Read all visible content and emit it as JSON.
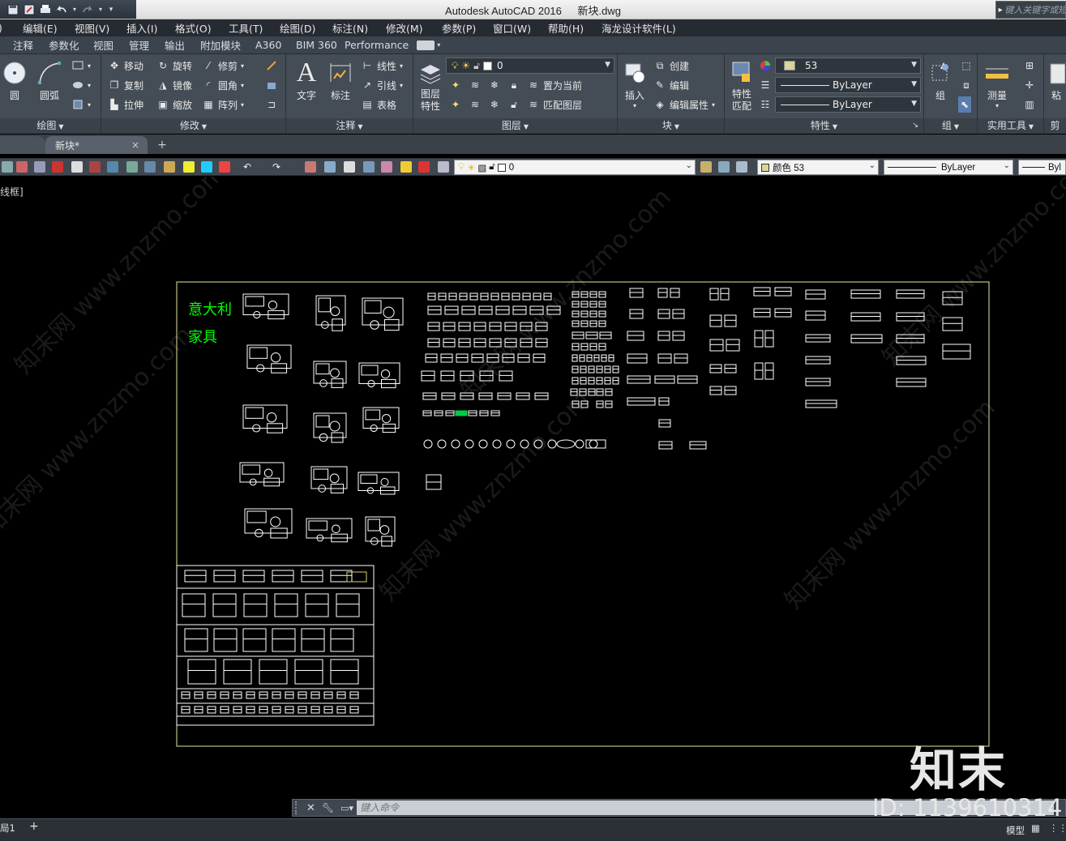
{
  "window": {
    "app_name": "Autodesk AutoCAD 2016",
    "file_name": "新块.dwg",
    "keyword_search_placeholder": "键入关键字或短语"
  },
  "menu": [
    "编辑(E)",
    "视图(V)",
    "插入(I)",
    "格式(O)",
    "工具(T)",
    "绘图(D)",
    "标注(N)",
    "修改(M)",
    "参数(P)",
    "窗口(W)",
    "帮助(H)",
    "海龙设计软件(L)"
  ],
  "ribbon_tabs": [
    "注释",
    "参数化",
    "视图",
    "管理",
    "输出",
    "附加模块",
    "A360",
    "BIM 360",
    "Performance"
  ],
  "ribbon": {
    "draw": {
      "title": "绘图",
      "circle": "圆",
      "arc": "圆弧"
    },
    "modify": {
      "title": "修改",
      "move": "移动",
      "rotate": "旋转",
      "trim": "修剪",
      "copy": "复制",
      "mirror": "镜像",
      "fillet": "圆角",
      "stretch": "拉伸",
      "scale": "缩放",
      "array": "阵列"
    },
    "annotation": {
      "title": "注释",
      "text": "文字",
      "dimension": "标注",
      "linear": "线性",
      "leader": "引线",
      "table": "表格"
    },
    "layers": {
      "title": "图层",
      "layer_properties": "图层特性",
      "current_layer": "0",
      "set_current": "置为当前",
      "match_layer": "匹配图层"
    },
    "block": {
      "title": "块",
      "insert": "插入",
      "create": "创建",
      "edit": "编辑",
      "edit_attributes": "编辑属性"
    },
    "properties": {
      "title": "特性",
      "match_properties": "特性匹配",
      "color": "53",
      "linetype": "ByLayer",
      "lineweight": "ByLayer"
    },
    "groups": {
      "title": "组",
      "group": "组"
    },
    "utilities": {
      "title": "实用工具",
      "measure": "测量"
    },
    "clipboard": {
      "title": "剪",
      "paste": "粘"
    }
  },
  "file_tabs": {
    "active": "新块*"
  },
  "toolbar": {
    "layer_value": "0",
    "color_value": "颜色 53",
    "linetype_value": "ByLayer",
    "lineweight_value": "Byl"
  },
  "viewport": {
    "label": "线框]"
  },
  "drawing": {
    "title_line1": "意大利",
    "title_line2": "家具",
    "border_color": "#e6e6a0",
    "block_color": "#ffffff",
    "label_color": "#00ff00"
  },
  "command_line": {
    "placeholder": "键入命令"
  },
  "status": {
    "layout_tab": "局1",
    "model": "模型"
  },
  "watermark": {
    "brand": "知末",
    "id": "ID: 1139610314",
    "site": "知末网 www.znzmo.com"
  }
}
